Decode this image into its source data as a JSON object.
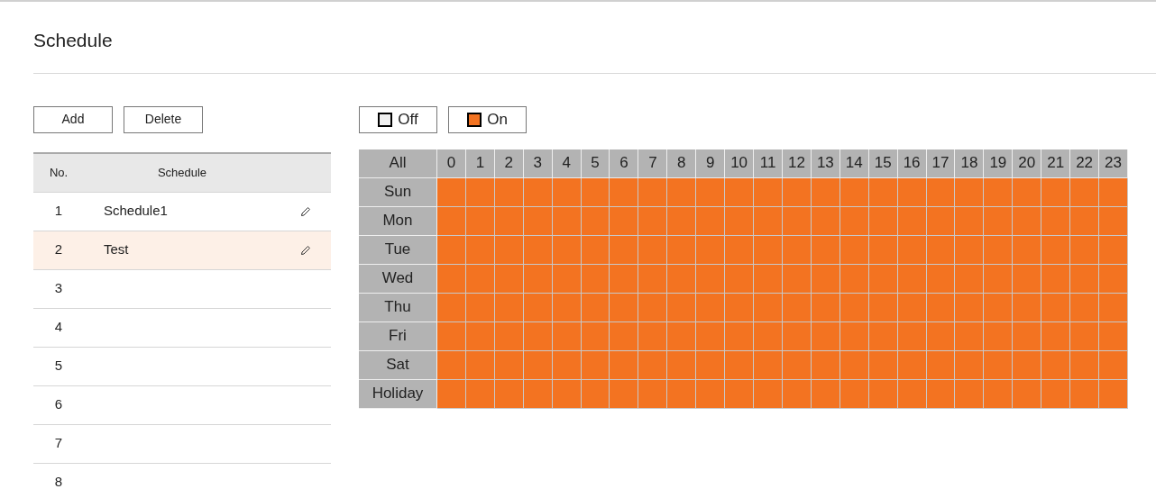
{
  "title": "Schedule",
  "buttons": [
    "Add",
    "Delete"
  ],
  "table": {
    "columns": [
      "No.",
      "Schedule"
    ],
    "rows": [
      {
        "no": "1",
        "name": "Schedule1",
        "editable": true,
        "selected": false
      },
      {
        "no": "2",
        "name": "Test",
        "editable": true,
        "selected": true
      },
      {
        "no": "3",
        "editable": false,
        "selected": false
      },
      {
        "no": "4",
        "editable": false,
        "selected": false
      },
      {
        "no": "5",
        "editable": false,
        "selected": false
      },
      {
        "no": "6",
        "editable": false,
        "selected": false
      },
      {
        "no": "7",
        "editable": false,
        "selected": false
      },
      {
        "no": "8",
        "editable": false,
        "selected": false
      }
    ]
  },
  "legend": [
    {
      "label": "Off",
      "on": false
    },
    {
      "label": "On",
      "on": true
    }
  ],
  "grid": {
    "corner": "All",
    "hours": [
      "0",
      "1",
      "2",
      "3",
      "4",
      "5",
      "6",
      "7",
      "8",
      "9",
      "10",
      "11",
      "12",
      "13",
      "14",
      "15",
      "16",
      "17",
      "18",
      "19",
      "20",
      "21",
      "22",
      "23"
    ],
    "days": [
      {
        "label": "Sun",
        "on": [
          true,
          true,
          true,
          true,
          true,
          true,
          true,
          true,
          true,
          true,
          true,
          true,
          true,
          true,
          true,
          true,
          true,
          true,
          true,
          true,
          true,
          true,
          true,
          true
        ]
      },
      {
        "label": "Mon",
        "on": [
          true,
          true,
          true,
          true,
          true,
          true,
          true,
          true,
          true,
          true,
          true,
          true,
          true,
          true,
          true,
          true,
          true,
          true,
          true,
          true,
          true,
          true,
          true,
          true
        ]
      },
      {
        "label": "Tue",
        "on": [
          true,
          true,
          true,
          true,
          true,
          true,
          true,
          true,
          true,
          true,
          true,
          true,
          true,
          true,
          true,
          true,
          true,
          true,
          true,
          true,
          true,
          true,
          true,
          true
        ]
      },
      {
        "label": "Wed",
        "on": [
          true,
          true,
          true,
          true,
          true,
          true,
          true,
          true,
          true,
          true,
          true,
          true,
          true,
          true,
          true,
          true,
          true,
          true,
          true,
          true,
          true,
          true,
          true,
          true
        ]
      },
      {
        "label": "Thu",
        "on": [
          true,
          true,
          true,
          true,
          true,
          true,
          true,
          true,
          true,
          true,
          true,
          true,
          true,
          true,
          true,
          true,
          true,
          true,
          true,
          true,
          true,
          true,
          true,
          true
        ]
      },
      {
        "label": "Fri",
        "on": [
          true,
          true,
          true,
          true,
          true,
          true,
          true,
          true,
          true,
          true,
          true,
          true,
          true,
          true,
          true,
          true,
          true,
          true,
          true,
          true,
          true,
          true,
          true,
          true
        ]
      },
      {
        "label": "Sat",
        "on": [
          true,
          true,
          true,
          true,
          true,
          true,
          true,
          true,
          true,
          true,
          true,
          true,
          true,
          true,
          true,
          true,
          true,
          true,
          true,
          true,
          true,
          true,
          true,
          true
        ]
      },
      {
        "label": "Holiday",
        "on": [
          true,
          true,
          true,
          true,
          true,
          true,
          true,
          true,
          true,
          true,
          true,
          true,
          true,
          true,
          true,
          true,
          true,
          true,
          true,
          true,
          true,
          true,
          true,
          true
        ]
      }
    ]
  }
}
